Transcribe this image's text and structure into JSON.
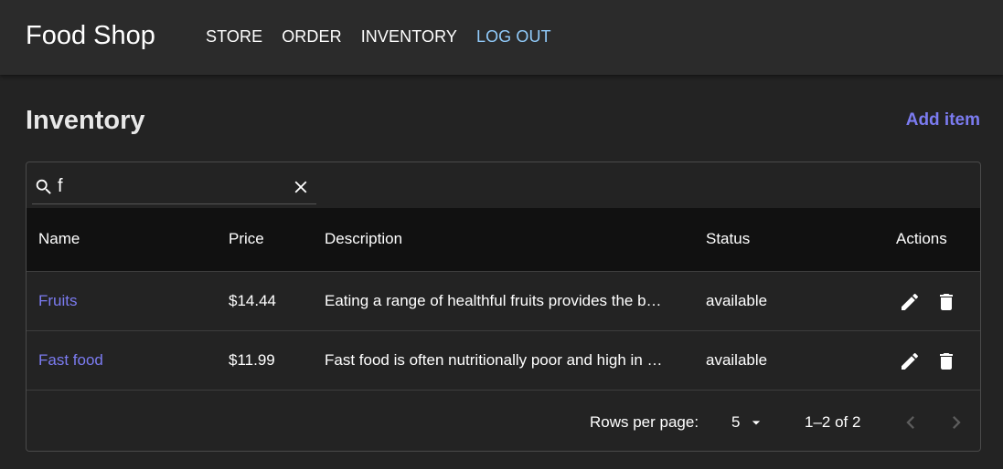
{
  "app": {
    "brand": "Food Shop",
    "nav": [
      {
        "label": "STORE"
      },
      {
        "label": "ORDER"
      },
      {
        "label": "INVENTORY"
      },
      {
        "label": "LOG OUT"
      }
    ]
  },
  "page": {
    "title": "Inventory",
    "add_label": "Add item"
  },
  "search": {
    "value": "f",
    "icon": "search-icon",
    "clear_icon": "close-icon"
  },
  "table": {
    "columns": [
      "Name",
      "Price",
      "Description",
      "Status",
      "Actions"
    ],
    "rows": [
      {
        "name": "Fruits",
        "price": "$14.44",
        "description": "Eating a range of healthful fruits provides the b…",
        "status": "available"
      },
      {
        "name": "Fast food",
        "price": "$11.99",
        "description": "Fast food is often nutritionally poor and high in …",
        "status": "available"
      }
    ]
  },
  "pagination": {
    "rows_per_page_label": "Rows per page:",
    "rows_per_page": "5",
    "range": "1–2 of 2"
  },
  "colors": {
    "background": "#232323",
    "appbar": "#2b2b2b",
    "accent_link": "#7b7bf0",
    "logout": "#90caf9",
    "table_header": "#111111"
  }
}
